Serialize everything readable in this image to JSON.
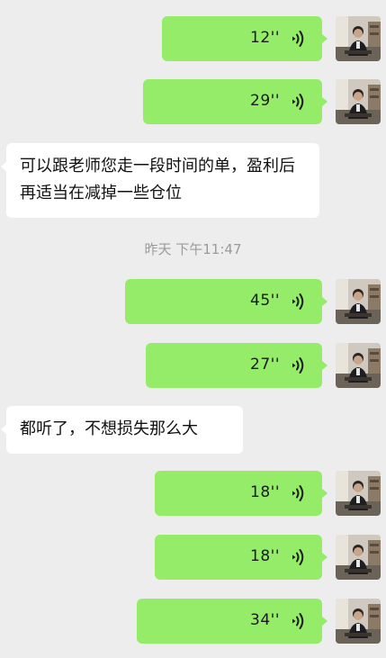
{
  "messages": {
    "m1": {
      "duration": "12''"
    },
    "m2": {
      "duration": "29''"
    },
    "m3": {
      "text": "可以跟老师您走一段时间的单，盈利后再适当在减掉一些仓位"
    },
    "timestamp": "昨天 下午11:47",
    "m4": {
      "duration": "45''"
    },
    "m5": {
      "duration": "27''"
    },
    "m6": {
      "text": "都听了，不想损失那么大"
    },
    "m7": {
      "duration": "18''"
    },
    "m8": {
      "duration": "18''"
    },
    "m9": {
      "duration": "34''"
    }
  },
  "icons": {
    "voice": "voice-wave-icon",
    "avatar": "user-avatar"
  },
  "colors": {
    "background": "#ededed",
    "sent_bubble": "#95ec69",
    "received_bubble": "#ffffff",
    "timestamp": "#9a9a9a"
  }
}
